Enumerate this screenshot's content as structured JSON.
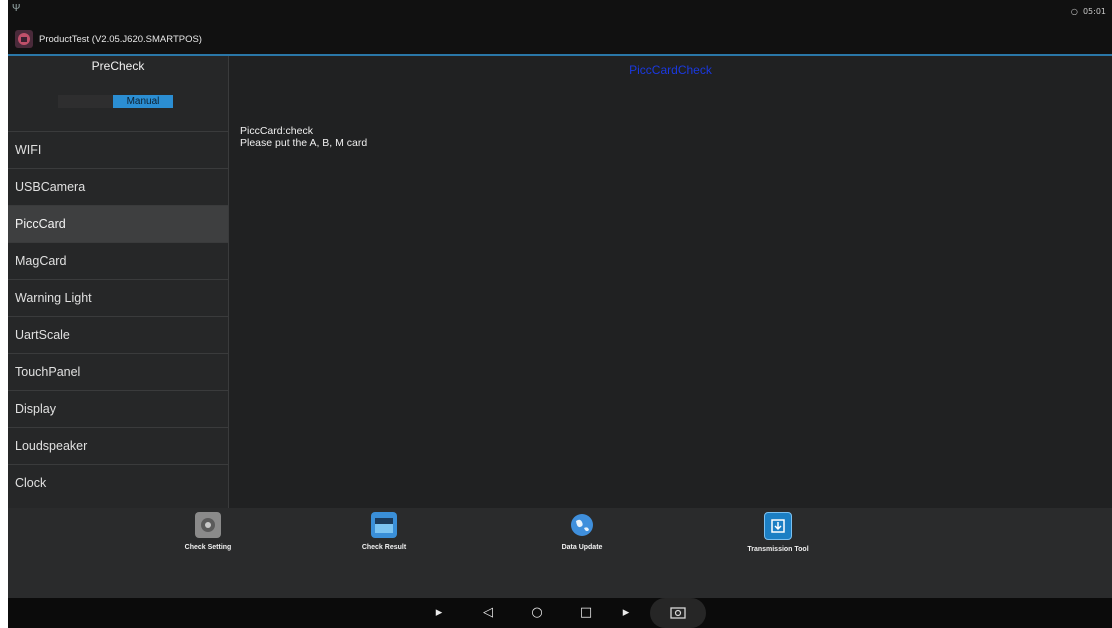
{
  "app": {
    "title": "ProductTest (V2.05.J620.SMARTPOS)"
  },
  "statusbar": {
    "time": "05:01"
  },
  "sidebar": {
    "header": "PreCheck",
    "mode_button": "Manual",
    "items": [
      {
        "label": "WIFI"
      },
      {
        "label": "USBCamera"
      },
      {
        "label": "PiccCard"
      },
      {
        "label": "MagCard"
      },
      {
        "label": "Warning Light"
      },
      {
        "label": "UartScale"
      },
      {
        "label": "TouchPanel"
      },
      {
        "label": "Display"
      },
      {
        "label": "Loudspeaker"
      },
      {
        "label": "Clock"
      }
    ]
  },
  "main": {
    "title": "PiccCardCheck",
    "message_line1": "PiccCard:check",
    "message_line2": "Please put the A, B, M card"
  },
  "toolbar": {
    "check_setting": "Check Setting",
    "check_result": "Check Result",
    "data_update": "Data Update",
    "transmission_tool": "Transmission Tool"
  },
  "colors": {
    "title_accent": "#1a39e0",
    "manual_button": "#2b8ed3",
    "titlebar_underline": "#2a77a8"
  }
}
